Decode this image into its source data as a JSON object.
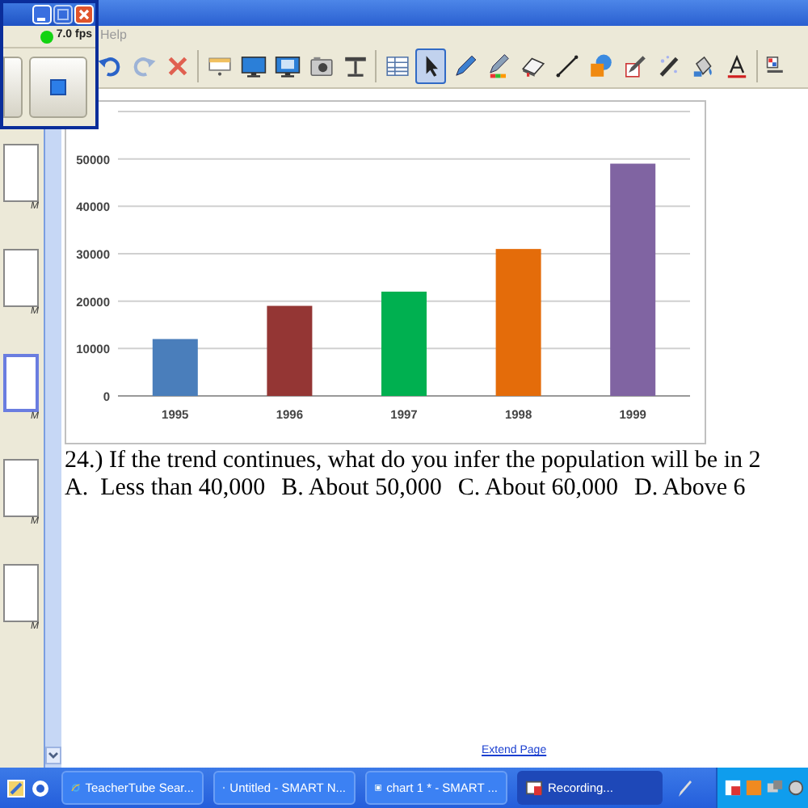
{
  "recorder": {
    "fps": "7.0 fps"
  },
  "menu": [
    "Help"
  ],
  "toolbar": {
    "groups": [
      [
        {
          "kind": "undo",
          "selected": false
        },
        {
          "kind": "redo",
          "selected": false
        },
        {
          "kind": "delete",
          "selected": false
        }
      ],
      [
        {
          "kind": "shade",
          "selected": false
        },
        {
          "kind": "monitor",
          "selected": false
        },
        {
          "kind": "monitor2",
          "selected": false
        },
        {
          "kind": "camera",
          "selected": false
        },
        {
          "kind": "document",
          "selected": false
        }
      ],
      [
        {
          "kind": "table",
          "selected": false
        },
        {
          "kind": "select",
          "selected": true
        },
        {
          "kind": "pen",
          "selected": false
        },
        {
          "kind": "creative",
          "selected": false
        },
        {
          "kind": "eraser",
          "selected": false
        },
        {
          "kind": "line",
          "selected": false
        },
        {
          "kind": "shapes",
          "selected": false
        },
        {
          "kind": "magicpen",
          "selected": false
        },
        {
          "kind": "wand",
          "selected": false
        },
        {
          "kind": "fill",
          "selected": false
        },
        {
          "kind": "text",
          "selected": false
        }
      ],
      [
        {
          "kind": "palette",
          "selected": false
        }
      ]
    ]
  },
  "page_sorter": {
    "pages": [
      {
        "label": "M",
        "selected": false
      },
      {
        "label": "M",
        "selected": false
      },
      {
        "label": "M",
        "selected": true
      },
      {
        "label": "M",
        "selected": false
      },
      {
        "label": "M",
        "selected": false
      }
    ]
  },
  "chart": {
    "chart_data": {
      "type": "bar",
      "categories": [
        "1995",
        "1996",
        "1997",
        "1998",
        "1999"
      ],
      "stacked": true,
      "grid": true,
      "series": [
        {
          "color": "#4a7ebb",
          "values": [
            12000,
            null,
            null,
            null,
            null
          ]
        },
        {
          "color": "#943634",
          "values": [
            null,
            19000,
            null,
            null,
            null
          ]
        },
        {
          "color": "#00b050",
          "values": [
            null,
            null,
            22000,
            null,
            null
          ]
        },
        {
          "color": "#e46c0a",
          "values": [
            null,
            null,
            null,
            31000,
            null
          ]
        },
        {
          "color": "#8064a2",
          "values": [
            null,
            null,
            null,
            null,
            49000
          ]
        }
      ],
      "ylim": [
        0,
        60000
      ],
      "yticks": [
        0,
        10000,
        20000,
        30000,
        40000,
        50000
      ]
    }
  },
  "question": {
    "prompt": "24.) If the trend continues, what do you infer the population will be in 2",
    "choices": [
      "A.  Less than 40,000",
      "B. About 50,000",
      "C. About 60,000",
      "D. Above 6"
    ]
  },
  "extend_page_link": "Extend Page",
  "taskbar": {
    "buttons": [
      {
        "kind": "browser",
        "label": "TeacherTube Sear...",
        "selected": false
      },
      {
        "kind": "notebook",
        "label": "Untitled - SMART N...",
        "selected": false
      },
      {
        "kind": "notebook",
        "label": "chart 1 * - SMART ...",
        "selected": false
      },
      {
        "kind": "recorder",
        "label": "Recording...",
        "selected": true
      }
    ]
  }
}
